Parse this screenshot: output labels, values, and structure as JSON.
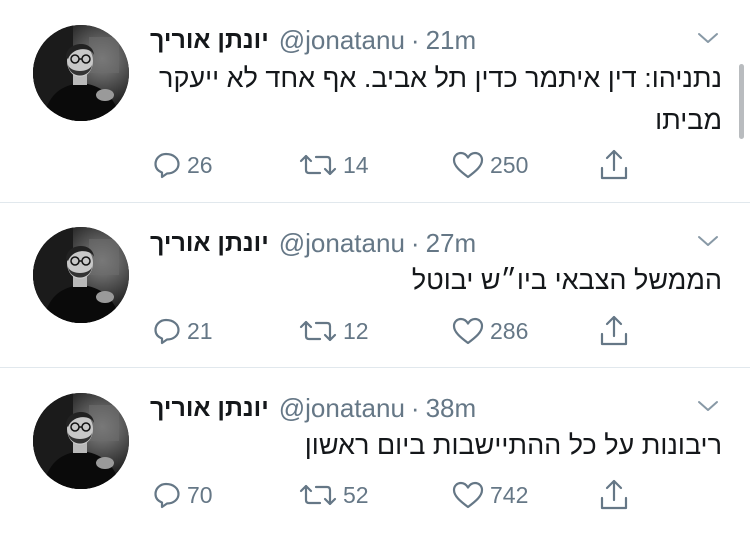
{
  "tweets": [
    {
      "name": "יונתן אוריך",
      "handle": "@jonatanu",
      "separator": "·",
      "time": "21m",
      "text": "נתניהו: דין איתמר כדין תל אביב. אף אחד לא ייעקר מביתו",
      "replies": "26",
      "retweets": "14",
      "likes": "250"
    },
    {
      "name": "יונתן אוריך",
      "handle": "@jonatanu",
      "separator": "·",
      "time": "27m",
      "text": "הממשל הצבאי ביו״ש יבוטל",
      "replies": "21",
      "retweets": "12",
      "likes": "286"
    },
    {
      "name": "יונתן אוריך",
      "handle": "@jonatanu",
      "separator": "·",
      "time": "38m",
      "text": "ריבונות על כל ההתיישבות ביום ראשון",
      "replies": "70",
      "retweets": "52",
      "likes": "742"
    }
  ],
  "icons": {
    "reply": "reply-icon",
    "retweet": "retweet-icon",
    "like": "heart-icon",
    "share": "share-icon",
    "caret": "chevron-down-icon"
  },
  "colors": {
    "secondary_text": "#657786",
    "divider": "#e1e8ed",
    "primary_text": "#14171a"
  }
}
